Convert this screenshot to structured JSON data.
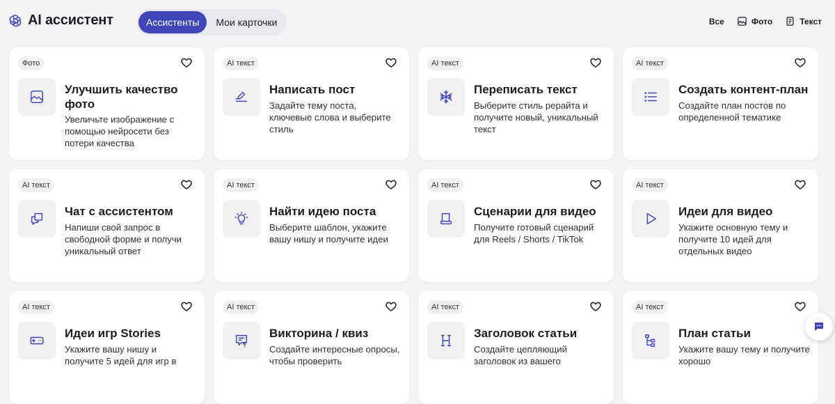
{
  "app": {
    "title": "AI ассистент"
  },
  "tabs": [
    {
      "label": "Ассистенты",
      "active": true
    },
    {
      "label": "Мои карточки",
      "active": false
    }
  ],
  "filters": {
    "all": "Все",
    "photo": "Фото",
    "text": "Текст"
  },
  "colors": {
    "accent": "#3f47b8",
    "background": "#f4f4f7",
    "card": "#ffffff",
    "icon": "#3f47b8"
  },
  "cards": [
    {
      "tag": "Фото",
      "icon": "image-icon",
      "title": "Улучшить качество фото",
      "desc": "Увеличьте изображение с помощью нейросети без потери качества"
    },
    {
      "tag": "AI текст",
      "icon": "pen-icon",
      "title": "Написать пост",
      "desc": "Задайте тему поста, ключевые слова и выберите стиль"
    },
    {
      "tag": "AI текст",
      "icon": "snowflake-icon",
      "title": "Переписать текст",
      "desc": "Выберите стиль рерайта и получите новый, уникальный текст"
    },
    {
      "tag": "AI текст",
      "icon": "list-icon",
      "title": "Создать контент-план",
      "desc": "Создайте план постов по определенной тематике"
    },
    {
      "tag": "AI текст",
      "icon": "chat-bubble-icon",
      "title": "Чат с ассистентом",
      "desc": "Напиши свой запрос в свободной форме и получи уникальный ответ"
    },
    {
      "tag": "AI текст",
      "icon": "lightbulb-icon",
      "title": "Найти идею поста",
      "desc": "Выберите шаблон, укажите вашу нишу и получите идеи"
    },
    {
      "tag": "AI текст",
      "icon": "script-icon",
      "title": "Сценарии для видео",
      "desc": "Получите готовый сценарий для Reels / Shorts / TikTok"
    },
    {
      "tag": "AI текст",
      "icon": "play-icon",
      "title": "Идеи для видео",
      "desc": "Укажите основную тему и получите 10 идей для отдельных видео"
    },
    {
      "tag": "AI текст",
      "icon": "gamepad-icon",
      "title": "Идеи игр Stories",
      "desc": "Укажите вашу нишу и получите 5 идей для игр в"
    },
    {
      "tag": "AI текст",
      "icon": "quiz-icon",
      "title": "Викторина / квиз",
      "desc": "Создайте интересные опросы, чтобы проверить"
    },
    {
      "tag": "AI текст",
      "icon": "heading-icon",
      "title": "Заголовок статьи",
      "desc": "Создайте цепляющий заголовок из вашего"
    },
    {
      "tag": "AI текст",
      "icon": "hierarchy-icon",
      "title": "План статьи",
      "desc": "Укажите вашу тему и получите хорошо"
    }
  ]
}
